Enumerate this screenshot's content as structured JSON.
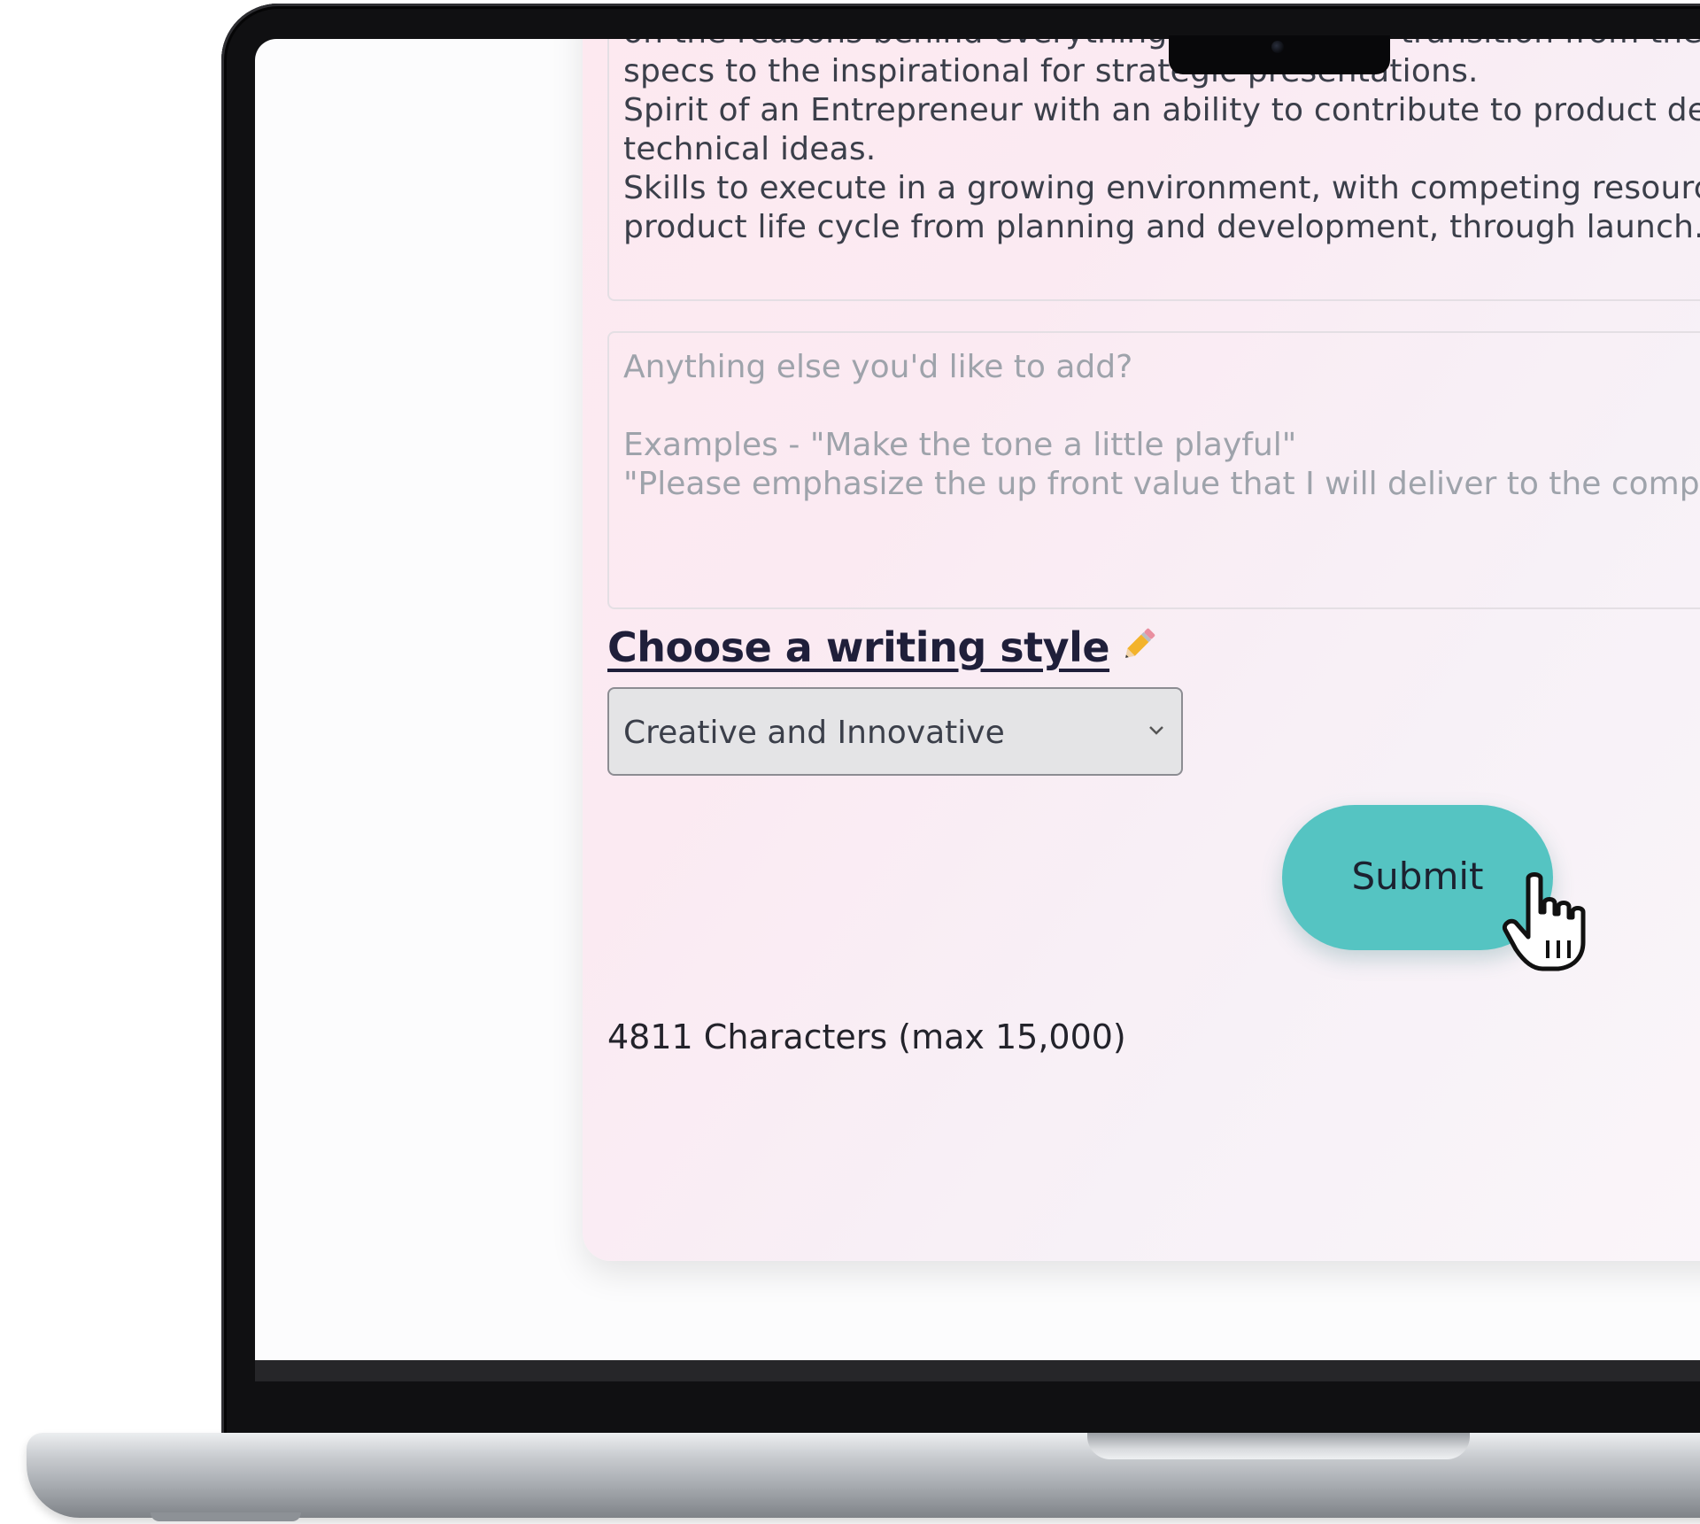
{
  "document_text": {
    "lines": [
      "on the reasons behind everything you do. Skills transition from the",
      "specs to the inspirational for strategic presentations.",
      "Spirit of an Entrepreneur with an ability to contribute to product design",
      "technical ideas.",
      "Skills to execute in a growing environment, with competing resources a",
      "product life cycle from planning and development, through launch."
    ]
  },
  "extra_input": {
    "placeholder_lines": [
      "Anything else you'd like to add?",
      "",
      "Examples - \"Make the tone a little playful\"",
      "\"Please emphasize the up front value that I will deliver to the company"
    ]
  },
  "writing_style": {
    "heading": "Choose a writing style",
    "heading_icon": "pencil-icon",
    "selected": "Creative and Innovative"
  },
  "submit": {
    "label": "Submit",
    "color": "#55c4c2"
  },
  "character_count": {
    "text": "4811 Characters (max 15,000)"
  }
}
